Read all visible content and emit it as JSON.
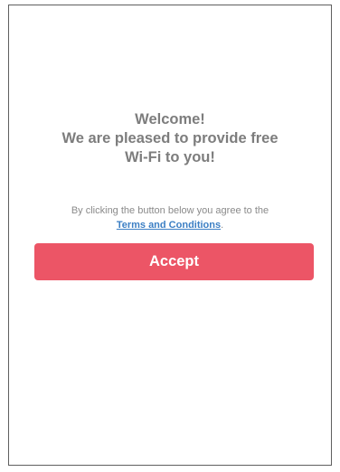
{
  "welcome": {
    "line1": "Welcome!",
    "line2": "We are pleased to provide free",
    "line3": "Wi-Fi to you!"
  },
  "consent": {
    "text": "By clicking the button below you agree to the",
    "link_label": "Terms and Conditions",
    "suffix": "."
  },
  "accept_button": {
    "label": "Accept"
  },
  "colors": {
    "accent": "#ec5566",
    "link": "#3c7fc4",
    "text": "#7d7d7d"
  }
}
